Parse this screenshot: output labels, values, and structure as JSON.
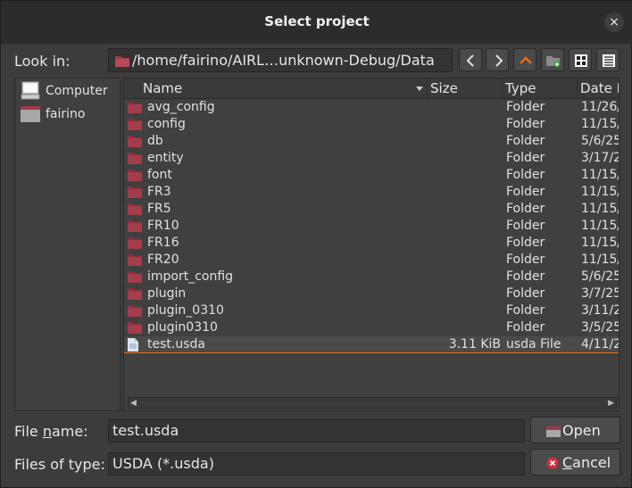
{
  "window": {
    "title": "Select project",
    "close_glyph": "×"
  },
  "toolbar": {
    "look_in_label": "Look in:",
    "path": "/home/fairino/AIRL…unknown-Debug/Data",
    "buttons": [
      {
        "name": "back-button",
        "icon": "chevron-left-icon"
      },
      {
        "name": "forward-button",
        "icon": "chevron-right-icon"
      },
      {
        "name": "parent-directory-button",
        "icon": "up-arrow-icon"
      },
      {
        "name": "new-folder-button",
        "icon": "new-folder-icon"
      },
      {
        "name": "list-view-button",
        "icon": "grid-view-icon"
      },
      {
        "name": "detail-view-button",
        "icon": "detail-view-icon"
      }
    ]
  },
  "sidebar": {
    "items": [
      {
        "label": "Computer",
        "icon": "computer-icon"
      },
      {
        "label": "fairino",
        "icon": "folder-icon"
      }
    ]
  },
  "filelist": {
    "columns": [
      "Name",
      "Size",
      "Type",
      "Date M"
    ],
    "rows": [
      {
        "name": "avg_config",
        "size": "",
        "type": "Folder",
        "date": "11/26/"
      },
      {
        "name": "config",
        "size": "",
        "type": "Folder",
        "date": "11/15/"
      },
      {
        "name": "db",
        "size": "",
        "type": "Folder",
        "date": "5/6/25"
      },
      {
        "name": "entity",
        "size": "",
        "type": "Folder",
        "date": "3/17/2"
      },
      {
        "name": "font",
        "size": "",
        "type": "Folder",
        "date": "11/15/"
      },
      {
        "name": "FR3",
        "size": "",
        "type": "Folder",
        "date": "11/15/"
      },
      {
        "name": "FR5",
        "size": "",
        "type": "Folder",
        "date": "11/15/"
      },
      {
        "name": "FR10",
        "size": "",
        "type": "Folder",
        "date": "11/15/"
      },
      {
        "name": "FR16",
        "size": "",
        "type": "Folder",
        "date": "11/15/"
      },
      {
        "name": "FR20",
        "size": "",
        "type": "Folder",
        "date": "11/15/"
      },
      {
        "name": "import_config",
        "size": "",
        "type": "Folder",
        "date": "5/6/25"
      },
      {
        "name": "plugin",
        "size": "",
        "type": "Folder",
        "date": "3/7/25"
      },
      {
        "name": "plugin_0310",
        "size": "",
        "type": "Folder",
        "date": "3/11/2"
      },
      {
        "name": "plugin0310",
        "size": "",
        "type": "Folder",
        "date": "3/5/25"
      },
      {
        "name": "test.usda",
        "size": "3.11 KiB",
        "type": "usda File",
        "date": "4/11/2",
        "selected": true
      }
    ]
  },
  "file_name": {
    "label_pre": "File ",
    "label_accel": "n",
    "label_post": "ame:",
    "value": "test.usda"
  },
  "file_type": {
    "label": "Files of type:",
    "value": "USDA (*.usda)"
  },
  "buttons": {
    "open": "Open",
    "cancel_accel": "C",
    "cancel_rest": "ancel"
  },
  "colors": {
    "accent": "#e07020",
    "folder": "#a03a48",
    "cancel_icon": "#d0303a"
  }
}
